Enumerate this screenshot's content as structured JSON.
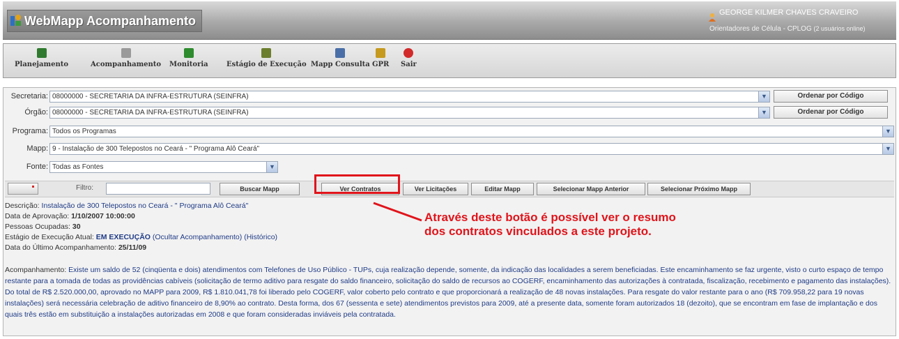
{
  "app": {
    "title": "WebMapp Acompanhamento",
    "user_name": "GEORGE KILMER CHAVES CRAVEIRO",
    "user_role": "Orientadores de Célula - CPLOG",
    "users_online": "(2 usuários online)"
  },
  "toolbar": {
    "items": [
      {
        "label": "Planejamento",
        "icon": "planning-icon",
        "color": "#2f7a2f"
      },
      {
        "label": "Acompanhamento",
        "icon": "tracking-icon",
        "color": "#8a8a8a"
      },
      {
        "label": "Monitoria",
        "icon": "monitor-icon",
        "color": "#2e8b2e"
      },
      {
        "label": "Estágio de Execução",
        "icon": "execution-stage-icon",
        "color": "#6b7e2e"
      },
      {
        "label": "Mapp Consulta",
        "icon": "query-icon",
        "color": "#4a6fa8"
      },
      {
        "label": "GPR",
        "icon": "gpr-icon",
        "color": "#c69a1f"
      },
      {
        "label": "Sair",
        "icon": "exit-icon",
        "color": "#d22a2a"
      }
    ]
  },
  "filters": {
    "secretaria": {
      "label": "Secretaria:",
      "value": "08000000 - SECRETARIA DA INFRA-ESTRUTURA (SEINFRA)"
    },
    "orgao": {
      "label": "Órgão:",
      "value": "08000000 - SECRETARIA DA INFRA-ESTRUTURA (SEINFRA)"
    },
    "programa": {
      "label": "Programa:",
      "value": "Todos os Programas"
    },
    "mapp": {
      "label": "Mapp:",
      "value": "9 - Instalação de 300 Telepostos no Ceará - \" Programa Alô Ceará\""
    },
    "fonte": {
      "label": "Fonte:",
      "value": "Todas as Fontes"
    },
    "order_button": "Ordenar por Código"
  },
  "actions": {
    "filter_label": "Filtro:",
    "filter_value": "",
    "buscar": "Buscar Mapp",
    "ver_contratos": "Ver Contratos",
    "ver_licitacoes": "Ver Licitações",
    "editar": "Editar Mapp",
    "anterior": "Selecionar Mapp Anterior",
    "proximo": "Selecionar Próximo Mapp"
  },
  "details": {
    "descricao_label": "Descrição:",
    "descricao": "Instalação de 300 Telepostos no Ceará - \" Programa Alô Ceará\"",
    "aprovacao_label": "Data de Aprovação:",
    "aprovacao": "1/10/2007 10:00:00",
    "pessoas_label": "Pessoas Ocupadas:",
    "pessoas": "30",
    "estagio_label": "Estágio de Execução Atual:",
    "estagio": "EM EXECUÇÃO",
    "ocultar": "(Ocultar Acompanhamento)",
    "historico": "(Histórico)",
    "ultimo_label": "Data do Último Acompanhamento:",
    "ultimo": "25/11/09",
    "acomp_label": "Acompanhamento:",
    "acomp_text": "Existe um saldo de 52 (cinqüenta e dois) atendimentos com Telefones de Uso Público - TUPs, cuja realização depende, somente, da indicação das localidades a serem beneficiadas. Este encaminhamento se faz urgente, visto o curto espaço de tempo restante para a tomada de todas as providências cabíveis (solicitação de termo aditivo para resgate do saldo financeiro, solicitação do saldo de recursos ao COGERF, encaminhamento das autorizações à contratada, fiscalização, recebimento e pagamento das instalações). Do total de R$ 2.520.000,00, aprovado no MAPP para 2009, R$ 1.810.041,78 foi liberado pelo COGERF, valor coberto pelo contrato e que proporcionará a realização de 48 novas instalações. Para resgate do valor restante para o ano (R$ 709.958,22 para 19 novas instalações) será necessária celebração de aditivo financeiro de 8,90% ao contrato. Desta forma, dos 67 (sessenta e sete) atendimentos previstos para 2009, até a presente data, somente foram autorizados 18 (dezoito), que se encontram em fase de implantação e dos quais três estão em substituição a instalações autorizadas em 2008 e que foram consideradas inviáveis pela contratada."
  },
  "annotation": {
    "line1": "Através deste botão é possível ver o resumo",
    "line2": "dos contratos vinculados a este projeto.",
    "color": "#e0141b"
  }
}
